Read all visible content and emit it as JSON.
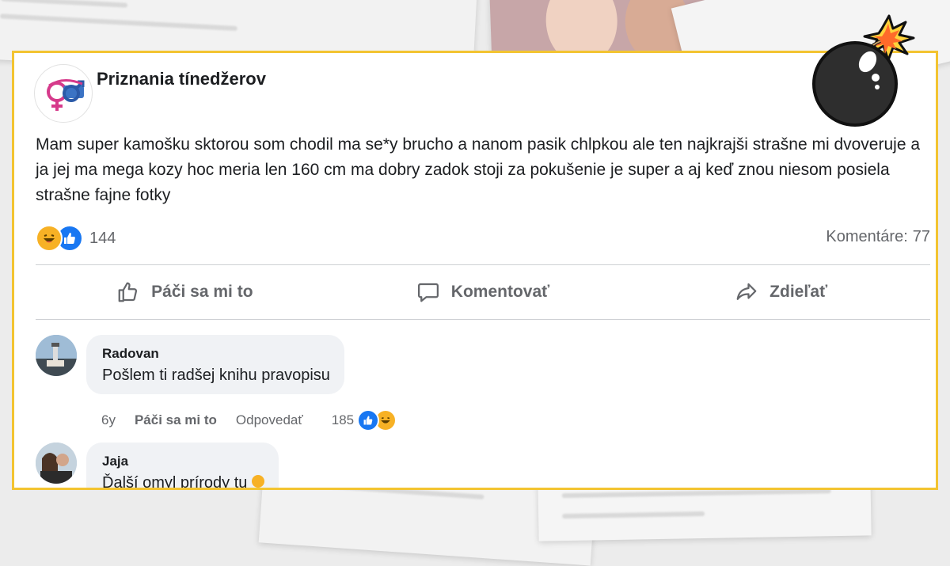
{
  "post": {
    "page_name": "Priznania tínedžerov",
    "text": "Mam super kamošku sktorou som chodil ma se*y brucho a nanom pasik chlpkou ale ten najkrajši strašne mi dvoveruje a ja jej ma mega kozy hoc meria len 160 cm ma dobry zadok stoji za pokušenie je super a aj keď znou niesom posiela strašne fajne fotky",
    "reaction_count": "144",
    "comments_label": "Komentáre:",
    "comments_value": "77"
  },
  "actions": {
    "like": "Páči sa mi to",
    "comment": "Komentovať",
    "share": "Zdieľať"
  },
  "comments": [
    {
      "author": "Radovan",
      "text": "Pošlem ti radšej knihu pravopisu",
      "time": "6y",
      "like_label": "Páči sa mi to",
      "reply_label": "Odpovedať",
      "reaction_count": "185"
    },
    {
      "author": "Jaja",
      "text": "Ďalší omyl prírody tu"
    }
  ],
  "colors": {
    "frame": "#f3c431",
    "like_blue": "#1877f2",
    "haha_yellow": "#f7b125",
    "muted_text": "#65676b"
  }
}
